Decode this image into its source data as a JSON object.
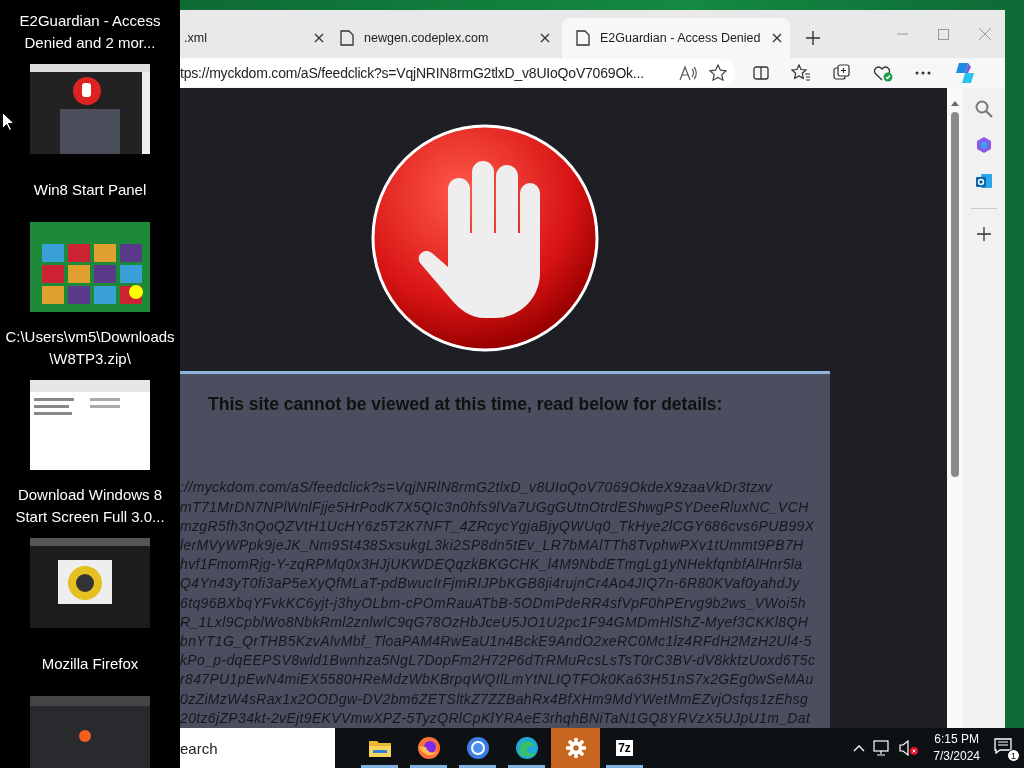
{
  "switcher": {
    "items": [
      {
        "title": "E2Guardian - Access Denied and 2 mor..."
      },
      {
        "title": "Win8 Start Panel"
      },
      {
        "title": "C:\\Users\\vm5\\Downloads\n\\W8TP3.zip\\"
      },
      {
        "title": "Download Windows 8 Start Screen Full 3.0..."
      },
      {
        "title": "Mozilla Firefox"
      }
    ]
  },
  "browser": {
    "tabs": [
      {
        "label": ".xml",
        "selected": false
      },
      {
        "label": "newgen.codeplex.com",
        "selected": false
      },
      {
        "label": "E2Guardian - Access Denied",
        "selected": true
      }
    ],
    "url": "tps://myckdom.com/aS/feedclick?s=VqjNRIN8rmG2tlxD_v8UIoQoV7069Ok...",
    "page": {
      "heading": "This site cannot be viewed at this time, read below for details:",
      "details": [
        "://myckdom.com/aS/feedclick?s=VqjNRlN8rmG2tlxD_v8UIoQoV7069OkdeX9zaaVkDr3tzxv",
        "mT71MrDN7NPlWnlFjje5HrPodK7X5QIc3n0hfs9lVa7UGgGUtnOtrdEShwgPSYDeeRluxNC_VCH",
        "mzgR5fh3nQoQZVtH1UcHY6z5T2K7NFT_4ZRcycYgjaBjyQWUq0_TkHye2lCGY686cvs6PUB99X",
        "lerMVyWPpk9jeJK_Nm9St438SxsukgL3ki2SP8dn5tEv_LR7bMAlTTh8TvphwPXv1tUmmt9PB7H",
        "hvf1FmomRjg-Y-zqRPMq0x3HJjUKWDEQqzkBKGCHK_l4M9NbdETmgLg1yNHekfqnbfAlHnr5la",
        "Q4Yn43yT0fi3aP5eXyQfMLaT-pdBwucIrFjmRIJPbKGB8ji4rujnCr4Ao4JIQ7n-6R80KVaf0yahdJy",
        "6tq96BXbqYFvkKC6yjt-j3hyOLbm-cPOmRauATbB-5ODmPdeRR4sfVpF0hPErvg9b2ws_VWoi5h",
        "R_1Lxl9CpblWo8NbkRml2znlwlC9qG78OzHbJceU5JO1U2pc1F94GMDmHlShZ-Myef3CKKl8QH",
        "bnYT1G_QrTHB5KzvAlvMbf_TloaPAM4RwEaU1n4BckE9AndO2xeRC0Mc1lz4RFdH2MzH2Ul4-5",
        "kPo_p-dqEEPSV8wld1Bwnhza5NgL7DopFm2H72P6dTrRMuRcsLsTsT0rC3BV-dV8kktzUoxd6T5c",
        "r847PU1pEwN4miEX5580HReMdzWbKBrpqWQIlLmYtNLIQTFOk0Ka63H51nS7x2GEg0wSeMAu",
        "0zZiMzW4sRax1x2OODgw-DV2bm6ZETSltkZ7ZZBahRx4BfXHm9MdYWetMmEZvjOsfqs1zEhsg",
        "20tz6jZP34kt-2vEjt9EKVVmwXPZ-5TyzQRlCpKlYRAeE3rhqhBNiTaN1GQ8YRVzX5UJpU1m_Dat"
      ]
    }
  },
  "taskbar": {
    "search": "earch",
    "apps": [
      {
        "kind": "explorer",
        "running": true,
        "selected": false
      },
      {
        "kind": "firefox",
        "running": true,
        "selected": false
      },
      {
        "kind": "chrome",
        "running": true,
        "selected": false
      },
      {
        "kind": "edge",
        "running": true,
        "selected": false
      },
      {
        "kind": "settings",
        "running": false,
        "selected": true
      },
      {
        "kind": "sevenzip",
        "label": "7z",
        "running": true,
        "selected": false
      }
    ],
    "time": "6:15 PM",
    "date": "7/3/2024",
    "notifications": "1"
  }
}
